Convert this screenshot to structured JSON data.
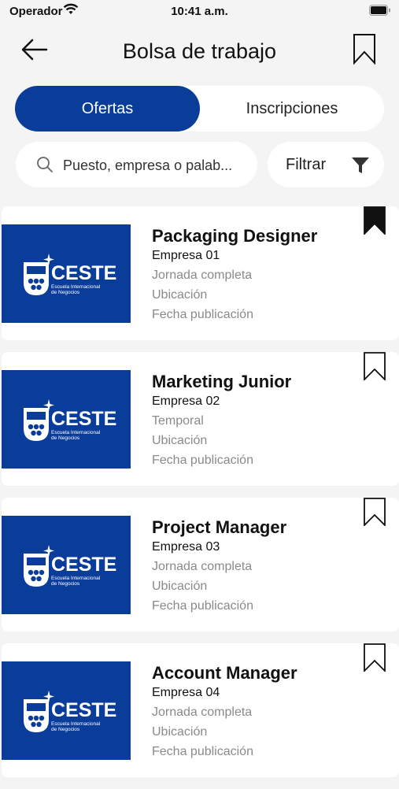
{
  "status_bar": {
    "carrier": "Operador",
    "time": "10:41 a.m."
  },
  "header": {
    "title": "Bolsa de trabajo"
  },
  "tabs": [
    {
      "label": "Ofertas",
      "active": true
    },
    {
      "label": "Inscripciones",
      "active": false
    }
  ],
  "search": {
    "placeholder": "Puesto, empresa o palab..."
  },
  "filter": {
    "label": "Filtrar"
  },
  "logo": {
    "brand": "CESTE",
    "subtitle_line1": "Escuela Internacional",
    "subtitle_line2": "de Negocios",
    "color": "#0a3d9a"
  },
  "jobs": [
    {
      "title": "Packaging Designer",
      "company": "Empresa 01",
      "schedule": "Jornada completa",
      "location": "Ubicación",
      "date": "Fecha publicación",
      "saved": true
    },
    {
      "title": "Marketing Junior",
      "company": "Empresa 02",
      "schedule": "Temporal",
      "location": "Ubicación",
      "date": "Fecha publicación",
      "saved": false
    },
    {
      "title": "Project Manager",
      "company": "Empresa 03",
      "schedule": "Jornada completa",
      "location": "Ubicación",
      "date": "Fecha publicación",
      "saved": false
    },
    {
      "title": "Account Manager",
      "company": "Empresa 04",
      "schedule": "Jornada completa",
      "location": "Ubicación",
      "date": "Fecha publicación",
      "saved": false
    }
  ]
}
